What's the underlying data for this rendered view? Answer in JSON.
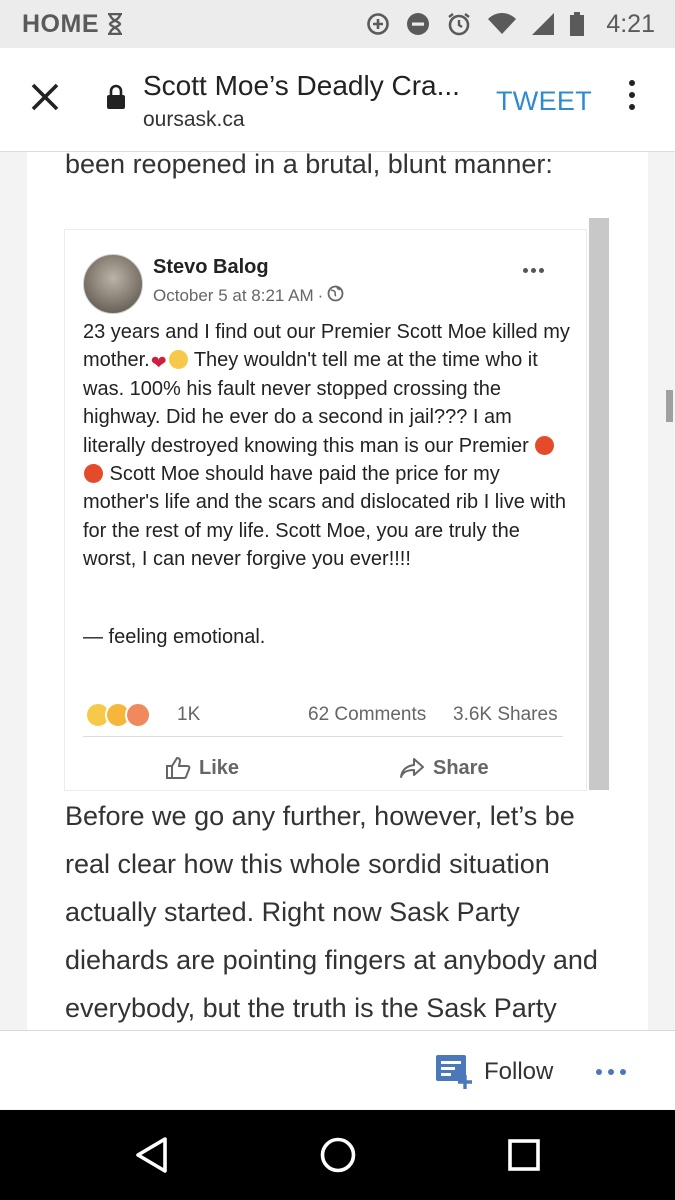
{
  "status_bar": {
    "label": "HOME",
    "time": "4:21",
    "icons": [
      "hourglass-icon",
      "data-saver-icon",
      "do-not-disturb-icon",
      "alarm-icon",
      "wifi-icon",
      "signal-icon",
      "battery-icon"
    ]
  },
  "toolbar": {
    "title": "Scott Moe’s Deadly Cra...",
    "url": "oursask.ca",
    "action_label": "TWEET",
    "accent_color": "#2e8bd0"
  },
  "article": {
    "text_before": "been reopened in a brutal, blunt manner:",
    "text_after": "Before we go any further, however, let’s be real clear how this whole sordid situation actually started. Right now Sask Party diehards are pointing fingers at anybody and everybody, but the truth is the Sask Party brought all of this on itself."
  },
  "embedded_post": {
    "author": "Stevo Balog",
    "date": "October 5 at 8:21 AM",
    "privacy_icon": "globe-icon",
    "body_part1": "23 years and I find out our Premier Scott Moe killed my mother.",
    "body_part2": " They wouldn't tell me at the time who it was. 100% his fault never stopped crossing the highway. Did he ever do a second in jail??? I am literally destroyed knowing this man is our Premier ",
    "body_part3": " Scott Moe should have paid the price for my mother's life and the scars and dislocated rib I live with for the rest of my life. Scott Moe, you are truly the worst, I can never forgive you ever!!!!",
    "feeling": "— feeling emotional.",
    "reaction_count": "1K",
    "comments": "62 Comments",
    "shares": "3.6K Shares",
    "like_label": "Like",
    "share_label": "Share"
  },
  "follow_bar": {
    "label": "Follow",
    "color": "#4a78b8"
  }
}
